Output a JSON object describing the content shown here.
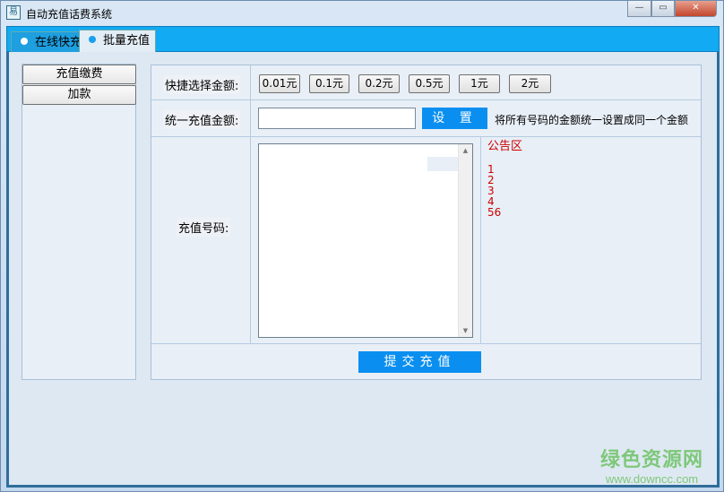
{
  "window": {
    "title": "自动充值话费系统",
    "app_icon": "易",
    "minimize": "—",
    "maximize": "▭",
    "close": "✕"
  },
  "tabs": [
    {
      "label": "在线快充"
    },
    {
      "label": "批量充值"
    }
  ],
  "left_panel": {
    "buttons": [
      {
        "label": "充值缴费"
      },
      {
        "label": "加款"
      }
    ]
  },
  "form": {
    "quick_label": "快捷选择金额:",
    "quick_amounts": [
      "0.01元",
      "0.1元",
      "0.2元",
      "0.5元",
      "1元",
      "2元"
    ],
    "unified_label": "统一充值金额:",
    "unified_value": "",
    "set_button": "设 置",
    "set_note": "将所有号码的金额统一设置成同一个金额",
    "numbers_label": "充值号码:",
    "numbers_value": "",
    "submit_button": "提交充值"
  },
  "notice": {
    "title": "公告区",
    "lines": [
      "1",
      "2",
      "3",
      "4",
      "56"
    ]
  },
  "watermark": {
    "cn": "绿色资源网",
    "url": "www.downcc.com"
  }
}
